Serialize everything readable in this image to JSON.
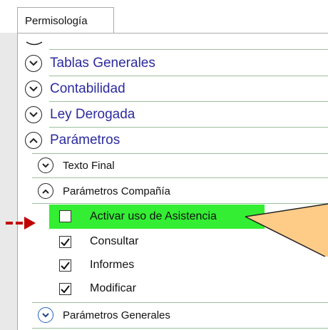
{
  "tab": {
    "label": "Permisología"
  },
  "tree": {
    "top_items": [
      {
        "label": "Tablas Generales",
        "state": "collapsed"
      },
      {
        "label": "Contabilidad",
        "state": "collapsed"
      },
      {
        "label": "Ley Derogada",
        "state": "collapsed"
      },
      {
        "label": "Parámetros",
        "state": "expanded"
      }
    ],
    "sub_items": [
      {
        "label": "Texto Final",
        "state": "collapsed"
      },
      {
        "label": "Parámetros Compañía",
        "state": "expanded"
      }
    ],
    "permissions": [
      {
        "label": "Activar uso de Asistencia",
        "checked": false,
        "highlighted": true
      },
      {
        "label": "Consultar",
        "checked": true
      },
      {
        "label": "Informes",
        "checked": true
      },
      {
        "label": "Modificar",
        "checked": true
      }
    ],
    "last_item": {
      "label": "Parámetros Generales",
      "state": "collapsed"
    }
  },
  "annotations": {
    "highlight_color": "#33ee33",
    "arrow_color": "#c00000",
    "callout_color": "#ffcc88"
  }
}
